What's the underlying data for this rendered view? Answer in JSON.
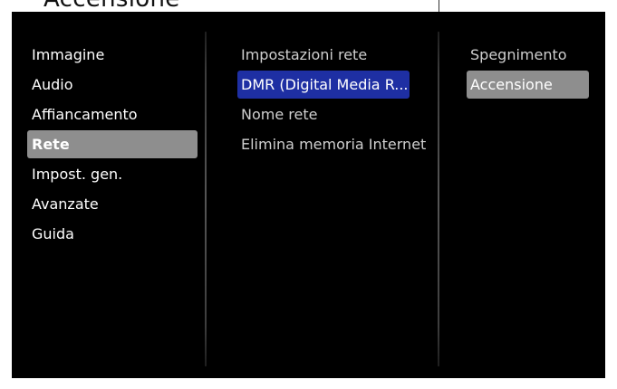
{
  "page_title": "Accensione",
  "main_menu": {
    "items": [
      {
        "label": "Immagine"
      },
      {
        "label": "Audio"
      },
      {
        "label": "Affiancamento"
      },
      {
        "label": "Rete"
      },
      {
        "label": "Impost. gen."
      },
      {
        "label": "Avanzate"
      },
      {
        "label": "Guida"
      }
    ],
    "selected": "Rete"
  },
  "sub_menu": {
    "items": [
      {
        "label": "Impostazioni rete"
      },
      {
        "label": "DMR (Digital Media R..."
      },
      {
        "label": "Nome rete"
      },
      {
        "label": "Elimina memoria Internet"
      }
    ],
    "focused": "DMR (Digital Media R..."
  },
  "option_menu": {
    "items": [
      {
        "label": "Spegnimento"
      },
      {
        "label": "Accensione"
      }
    ],
    "selected": "Accensione"
  },
  "colors": {
    "panel_background": "#000000",
    "selected_background": "#8e8e8e",
    "focused_background": "#1e2fa3",
    "text": "#ffffff"
  }
}
